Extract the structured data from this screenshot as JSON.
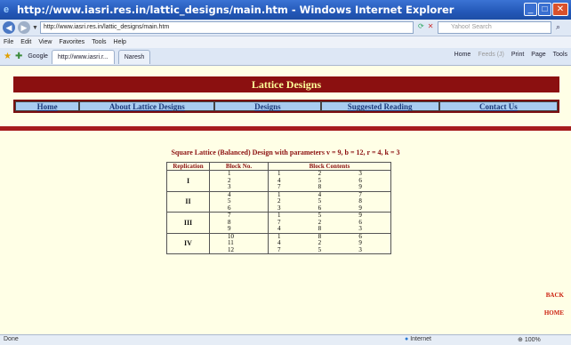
{
  "window": {
    "title": "http://www.iasri.res.in/lattic_designs/main.htm - Windows Internet Explorer",
    "minimize": "_",
    "maximize": "□",
    "close": "✕"
  },
  "addressbar": {
    "url": "http://www.iasri.res.in/lattic_designs/main.htm",
    "search_placeholder": "Yahoo! Search"
  },
  "menubar": [
    "File",
    "Edit",
    "View",
    "Favorites",
    "Tools",
    "Help"
  ],
  "toolbar": {
    "google": "Google",
    "tab1": "http://www.iasri.r...",
    "tab2": "Naresh",
    "home": "Home",
    "feeds": "Feeds (J)",
    "print": "Print",
    "page": "Page",
    "tools": "Tools"
  },
  "page": {
    "banner": "Lattice Designs",
    "nav": [
      "Home",
      "About Lattice Designs",
      "Designs",
      "Suggested Reading",
      "Contact Us"
    ],
    "heading": "Square Lattice (Balanced) Design with parameters v = 9, b = 12, r = 4, k = 3",
    "table": {
      "headers": [
        "Replication",
        "Block No.",
        "Block Contents"
      ],
      "replications": [
        {
          "label": "I",
          "blocks": [
            "1",
            "2",
            "3"
          ],
          "contents": [
            [
              "1",
              "2",
              "3"
            ],
            [
              "4",
              "5",
              "6"
            ],
            [
              "7",
              "8",
              "9"
            ]
          ]
        },
        {
          "label": "II",
          "blocks": [
            "4",
            "5",
            "6"
          ],
          "contents": [
            [
              "1",
              "4",
              "7"
            ],
            [
              "2",
              "5",
              "8"
            ],
            [
              "3",
              "6",
              "9"
            ]
          ]
        },
        {
          "label": "III",
          "blocks": [
            "7",
            "8",
            "9"
          ],
          "contents": [
            [
              "1",
              "5",
              "9"
            ],
            [
              "7",
              "2",
              "6"
            ],
            [
              "4",
              "8",
              "3"
            ]
          ]
        },
        {
          "label": "IV",
          "blocks": [
            "10",
            "11",
            "12"
          ],
          "contents": [
            [
              "1",
              "8",
              "6"
            ],
            [
              "4",
              "2",
              "9"
            ],
            [
              "7",
              "5",
              "3"
            ]
          ]
        }
      ]
    },
    "back": "BACK",
    "home_link": "HOME"
  },
  "statusbar": {
    "status": "Done",
    "zone": "Internet",
    "zoom": "100%"
  }
}
